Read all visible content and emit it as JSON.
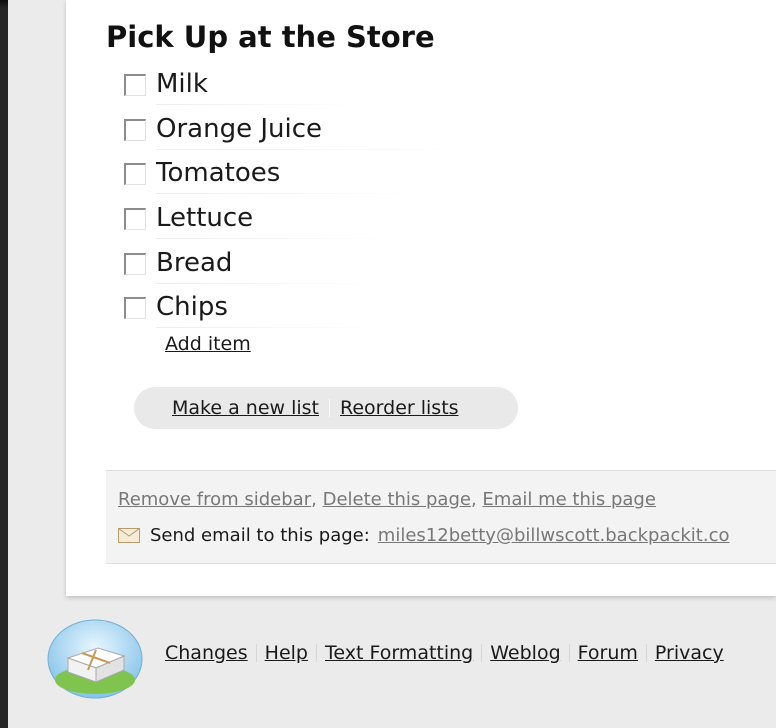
{
  "list": {
    "title": "Pick Up at the Store",
    "items": [
      {
        "label": "Milk",
        "checked": false
      },
      {
        "label": "Orange Juice",
        "checked": false
      },
      {
        "label": "Tomatoes",
        "checked": false
      },
      {
        "label": "Lettuce",
        "checked": false
      },
      {
        "label": "Bread",
        "checked": false
      },
      {
        "label": "Chips",
        "checked": false
      }
    ],
    "add_item_label": "Add item"
  },
  "list_actions": {
    "make_new_list": "Make a new list",
    "reorder_lists": "Reorder lists"
  },
  "page_actions": {
    "remove_from_sidebar": "Remove from sidebar",
    "delete_page": "Delete this page",
    "email_page": "Email me this page",
    "separator": ", "
  },
  "email": {
    "label": "Send email to this page:",
    "address": "miles12betty@billwscott.backpackit.co",
    "icon": "envelope-icon"
  },
  "footer": {
    "logo": "backpack-logo-icon",
    "links": [
      "Changes",
      "Help",
      "Text Formatting",
      "Weblog",
      "Forum",
      "Privacy"
    ]
  },
  "colors": {
    "background": "#262626",
    "window": "#ebebeb",
    "paper": "#ffffff",
    "link_muted": "#777777"
  }
}
